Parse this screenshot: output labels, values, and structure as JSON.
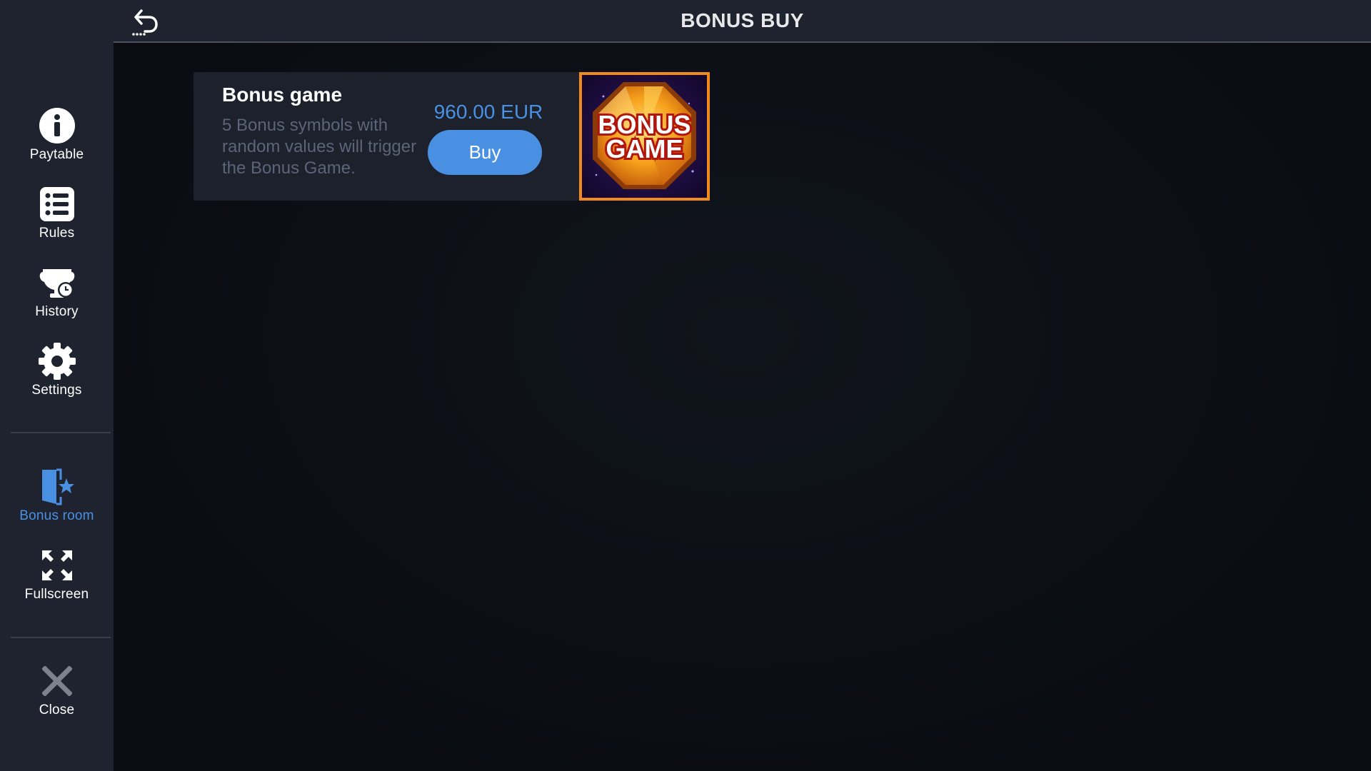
{
  "header": {
    "title": "BONUS BUY",
    "back_icon": "undo-arrow-icon"
  },
  "sidebar": {
    "items": [
      {
        "id": "paytable",
        "label": "Paytable",
        "icon": "info-icon",
        "active": false
      },
      {
        "id": "rules",
        "label": "Rules",
        "icon": "list-icon",
        "active": false
      },
      {
        "id": "history",
        "label": "History",
        "icon": "trophy-clock-icon",
        "active": false
      },
      {
        "id": "settings",
        "label": "Settings",
        "icon": "gear-icon",
        "active": false
      },
      {
        "id": "bonus-room",
        "label": "Bonus room",
        "icon": "door-star-icon",
        "active": true
      },
      {
        "id": "fullscreen",
        "label": "Fullscreen",
        "icon": "expand-icon",
        "active": false
      },
      {
        "id": "close",
        "label": "Close",
        "icon": "close-icon",
        "active": false
      }
    ]
  },
  "offer": {
    "title": "Bonus game",
    "description": "5 Bonus symbols with random values will trigger the Bonus Game.",
    "price": "960.00 EUR",
    "buy_label": "Buy",
    "image_text_line1": "BONUS",
    "image_text_line2": "GAME"
  },
  "colors": {
    "accent": "#4a90e2",
    "sidebar_bg": "#1f2330",
    "card_bg": "#1d212c",
    "image_border": "#f08a1c"
  }
}
